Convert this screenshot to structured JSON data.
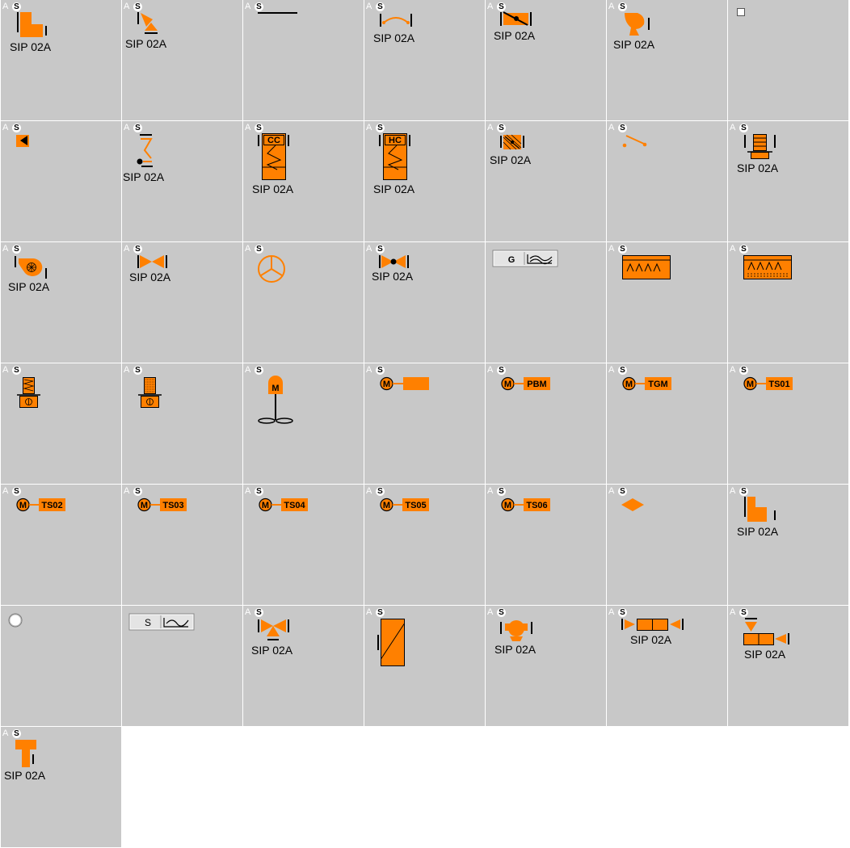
{
  "colors": {
    "accent": "#ff8000",
    "panel": "#c8c8c8",
    "stroke": "#000000"
  },
  "ao_text": "A",
  "s_text": "S",
  "sip": "SIP 02A",
  "motor": "M",
  "tags": {
    "pbm": "PBM",
    "tgm": "TGM",
    "ts01": "TS01",
    "ts02": "TS02",
    "ts03": "TS03",
    "ts04": "TS04",
    "ts05": "TS05",
    "ts06": "TS06",
    "cc": "CC",
    "hc": "HC",
    "g": "G",
    "s_sensor": "S"
  },
  "symbols": [
    "elbow-duct",
    "damper-valve",
    "line",
    "flex-connector",
    "butterfly-damper",
    "fan",
    "checkbox",
    "damper-small",
    "spring-return",
    "cooling-coil",
    "heating-coil",
    "mixing-box",
    "switch",
    "filter-unit",
    "centrifugal-fan",
    "gate-valve",
    "propeller-fan",
    "ball-valve",
    "gas-sensor",
    "humidifier",
    "steam-humidifier",
    "coil-filter",
    "bag-filter",
    "agitator",
    "motor-drive",
    "motor-pbm",
    "motor-tgm",
    "motor-ts01",
    "motor-ts02",
    "motor-ts03",
    "motor-ts04",
    "motor-ts05",
    "motor-ts06",
    "diamond",
    "elbow-duct-2",
    "radio",
    "s-sensor",
    "three-way-valve",
    "heat-exchanger",
    "pump",
    "silencer",
    "damper-duct",
    "tee-duct"
  ]
}
